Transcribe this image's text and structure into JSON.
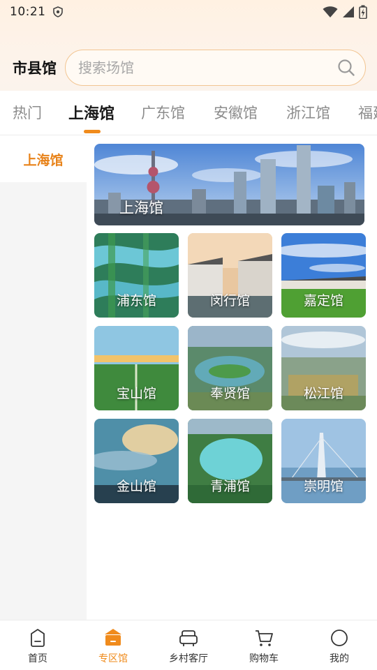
{
  "status_bar": {
    "time": "10:21"
  },
  "header": {
    "title": "市县馆",
    "search_placeholder": "搜索场馆"
  },
  "tabs": [
    {
      "label": "热门"
    },
    {
      "label": "上海馆",
      "active": true
    },
    {
      "label": "广东馆"
    },
    {
      "label": "安徽馆"
    },
    {
      "label": "浙江馆"
    },
    {
      "label": "福建馆"
    }
  ],
  "sidebar": {
    "items": [
      {
        "label": "上海馆",
        "selected": true
      }
    ]
  },
  "banner": {
    "label": "上海馆"
  },
  "venues": [
    {
      "label": "浦东馆"
    },
    {
      "label": "闵行馆"
    },
    {
      "label": "嘉定馆"
    },
    {
      "label": "宝山馆"
    },
    {
      "label": "奉贤馆"
    },
    {
      "label": "松江馆"
    },
    {
      "label": "金山馆"
    },
    {
      "label": "青浦馆"
    },
    {
      "label": "崇明馆"
    }
  ],
  "bottom_nav": [
    {
      "label": "首页",
      "icon": "home-icon"
    },
    {
      "label": "专区馆",
      "icon": "pavilion-icon",
      "active": true
    },
    {
      "label": "乡村客厅",
      "icon": "sofa-icon"
    },
    {
      "label": "购物车",
      "icon": "cart-icon"
    },
    {
      "label": "我的",
      "icon": "profile-icon"
    }
  ],
  "colors": {
    "accent": "#f08b1c",
    "search_border": "#f2c592",
    "header_bg": "#fff1e2",
    "sidebar_bg": "#f5f5f5"
  }
}
